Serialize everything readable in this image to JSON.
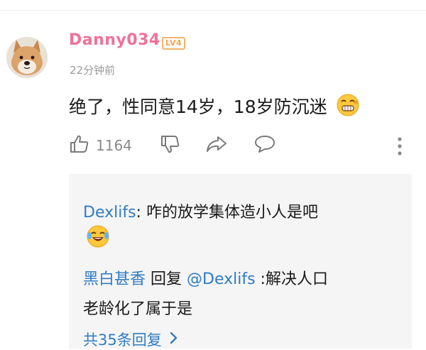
{
  "comment": {
    "username": "Danny034",
    "level_badge": "LV4",
    "time": "22分钟前",
    "text": "绝了，性同意14岁，18岁防沉迷",
    "likes": "1164"
  },
  "icons": {
    "avatar": "shiba-dog-avatar",
    "comment_emoji": "grimace-emoji",
    "like": "thumbs-up-icon",
    "dislike": "thumbs-down-icon",
    "share": "share-arrow-icon",
    "reply": "speech-bubble-icon",
    "more": "vertical-ellipsis-icon",
    "reply_emoji": "laugh-cry-emoji",
    "view_more": "chevron-right-icon"
  },
  "replies": [
    {
      "author": "Dexlifs",
      "sep": ": ",
      "text": "咋的放学集体造小人是吧"
    },
    {
      "author": "黑白甚香",
      "reply_word": " 回复 ",
      "target": "@Dexlifs",
      "text_line1": " :解决人口",
      "text_line2": "老龄化了属于是"
    }
  ],
  "view_more_label": "共35条回复",
  "colors": {
    "username": "#f07198",
    "link": "#2f7cc4",
    "badge": "#f5a34d",
    "reply_bg": "#f5f5f6"
  }
}
